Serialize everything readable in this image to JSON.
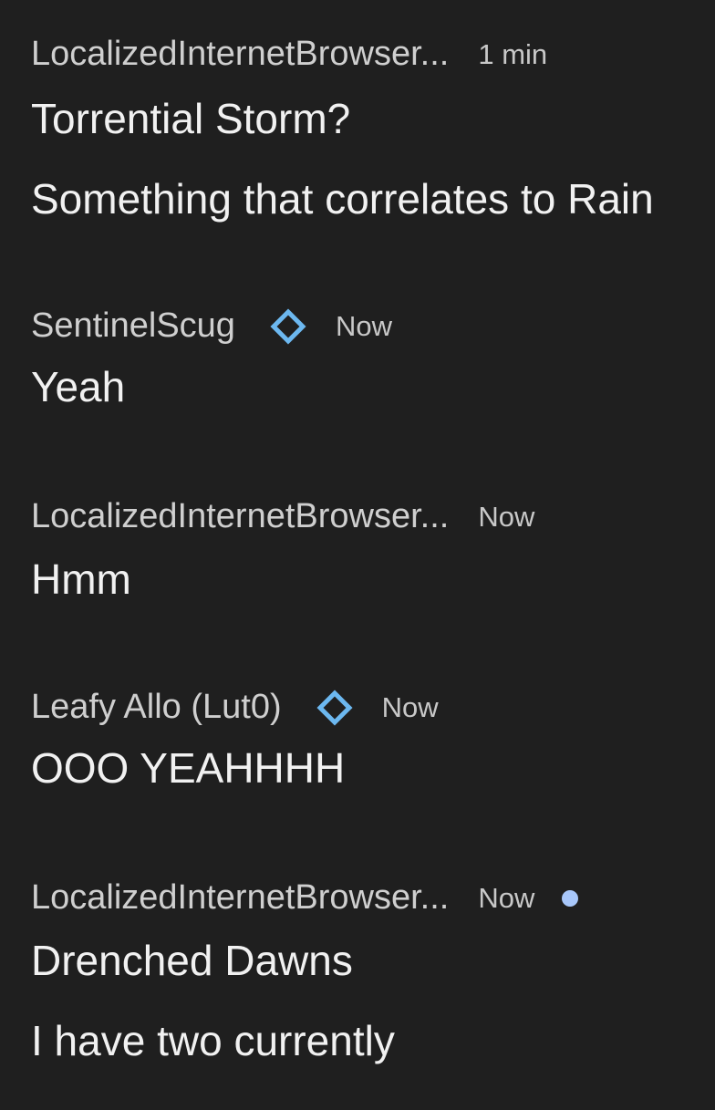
{
  "messages": [
    {
      "author": "LocalizedInternetBrowser...",
      "time": "1 min",
      "badge": null,
      "lines": [
        "Torrential Storm?",
        "Something that correlates to Rain"
      ]
    },
    {
      "author": "SentinelScug",
      "time": "Now",
      "badge": "diamond-badge-icon",
      "lines": [
        "Yeah"
      ]
    },
    {
      "author": "LocalizedInternetBrowser...",
      "time": "Now",
      "badge": null,
      "lines": [
        "Hmm"
      ]
    },
    {
      "author": "Leafy Allo (Lut0)",
      "time": "Now",
      "badge": "diamond-badge-icon",
      "lines": [
        "OOO YEAHHHH"
      ]
    },
    {
      "author": "LocalizedInternetBrowser...",
      "time": "Now",
      "badge": null,
      "unread": true,
      "lines": [
        "Drenched Dawns",
        "I have two currently"
      ]
    }
  ],
  "colors": {
    "background": "#1f1f1f",
    "badge": "#6cb8f0",
    "unread_dot": "#a8c7fa"
  }
}
